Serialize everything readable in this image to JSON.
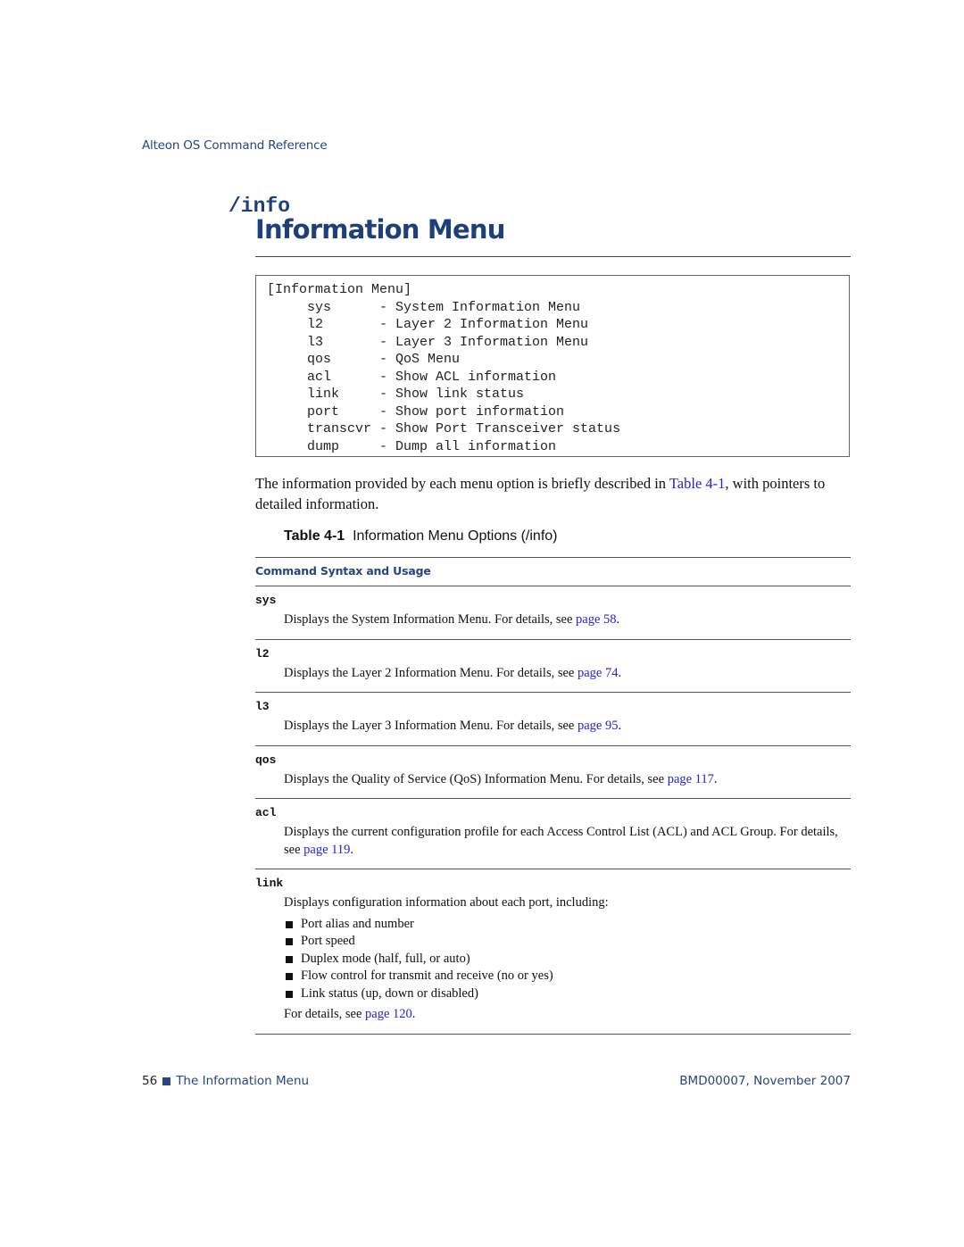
{
  "running_header": "Alteon OS Command Reference",
  "command_heading": "/info",
  "page_title": "Information Menu",
  "menu_box": {
    "lines": [
      "[Information Menu]",
      "     sys      - System Information Menu",
      "     l2       - Layer 2 Information Menu",
      "     l3       - Layer 3 Information Menu",
      "     qos      - QoS Menu",
      "     acl      - Show ACL information",
      "     link     - Show link status",
      "     port     - Show port information",
      "     transcvr - Show Port Transceiver status",
      "     dump     - Dump all information"
    ]
  },
  "intro": {
    "before": "The information provided by each menu option is briefly described in ",
    "link": "Table 4-1",
    "after": ", with pointers to detailed information."
  },
  "table_caption": {
    "label": "Table 4-1",
    "title": "Information Menu Options (/info)"
  },
  "table": {
    "column_header": "Command Syntax and Usage",
    "rows": [
      {
        "command": "sys",
        "text": "Displays the System Information Menu. For details, see ",
        "link": "page 58",
        "after": "."
      },
      {
        "command": "l2",
        "text": "Displays the Layer 2 Information Menu. For details, see ",
        "link": "page 74",
        "after": "."
      },
      {
        "command": "l3",
        "text": "Displays the Layer 3 Information Menu. For details, see ",
        "link": "page 95",
        "after": "."
      },
      {
        "command": "qos",
        "text": "Displays the Quality of Service (QoS) Information Menu. For details, see ",
        "link": "page 117",
        "after": "."
      },
      {
        "command": "acl",
        "text": "Displays the current configuration profile for each Access Control List (ACL) and ACL Group. For details, see ",
        "link": "page 119",
        "after": "."
      }
    ],
    "link_row": {
      "command": "link",
      "text": "Displays configuration information about each port, including:",
      "bullets": [
        "Port alias and number",
        "Port speed",
        "Duplex mode (half, full, or auto)",
        "Flow control for transmit and receive (no or yes)",
        "Link status (up, down or disabled)"
      ],
      "details_text": "For details, see ",
      "details_link": "page 120",
      "details_after": "."
    }
  },
  "footer": {
    "page_number": "56",
    "section": "The Information Menu",
    "doc_id": "BMD00007, November 2007"
  },
  "colors": {
    "heading_blue": "#1f3f7a",
    "link_blue": "#2222dd"
  }
}
